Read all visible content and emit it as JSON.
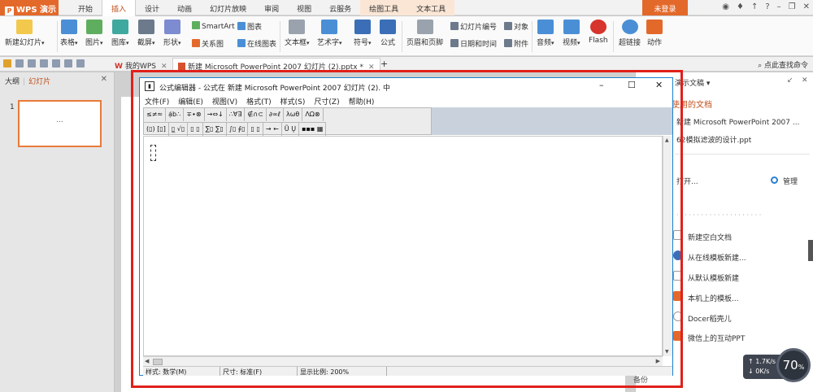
{
  "app": {
    "name": "WPS 演示"
  },
  "tabs": [
    "开始",
    "插入",
    "设计",
    "动画",
    "幻灯片放映",
    "审阅",
    "视图",
    "云服务",
    "绘图工具",
    "文本工具"
  ],
  "active_tab": "插入",
  "login_label": "未登录",
  "ribbon": {
    "new_slide": "新建幻灯片",
    "table": "表格",
    "picture": "图片",
    "gallery": "图库",
    "screenshot": "截屏",
    "shape": "形状",
    "smartart": "SmartArt",
    "chart": "图表",
    "relation": "关系图",
    "online_chart": "在线图表",
    "textbox": "文本框",
    "wordart": "艺术字",
    "symbol": "符号",
    "formula": "公式",
    "header_footer": "页眉和页脚",
    "slide_number": "幻灯片编号",
    "object": "对象",
    "datetime": "日期和时间",
    "attachment": "附件",
    "audio": "音频",
    "video": "视频",
    "flash": "Flash",
    "hyperlink": "超链接",
    "action": "动作"
  },
  "doc_tabs": {
    "mywps": "我的WPS",
    "current": "新建 Microsoft PowerPoint 2007 幻灯片 (2).pptx *",
    "add": "+"
  },
  "search_cmd": "点此查找命令",
  "left_panel": {
    "outline": "大纲",
    "slides": "幻灯片",
    "slide_number": "1",
    "thumb_text": "..."
  },
  "equation_editor": {
    "title": "公式编辑器 - 公式在 新建 Microsoft PowerPoint 2007 幻灯片 (2). 中",
    "menu": [
      "文件(F)",
      "编辑(E)",
      "视图(V)",
      "格式(T)",
      "样式(S)",
      "尺寸(Z)",
      "帮助(H)"
    ],
    "palette_row1": [
      "≤≠≈",
      "ạ̇b∴",
      "∓∙⊗",
      "→⇔↓",
      "∴∀∃",
      "∉∩⊂",
      "∂∞ℓ",
      "λωθ",
      "ΛΩ⊗"
    ],
    "palette_row2": [
      "(▯) [▯]",
      "▯̲ √▯",
      "▯ ▯",
      "∑▯ ∑▯",
      "∫▯ ∮▯",
      "▯ ▯",
      "→ ←",
      "Ũ Ų",
      "▪▪▪ ▦"
    ],
    "status_style": "样式: 数学(M)",
    "status_size": "尺寸: 标准(F)",
    "status_zoom": "显示比例: 200%"
  },
  "right_pane": {
    "header": "演示文稿",
    "recent_title": "使用的文档",
    "recent1": "新建 Microsoft PowerPoint 2007 ...",
    "recent2": "62模拟滤波的设计.ppt",
    "open": "打开...",
    "manage": "管理",
    "new_blank": "新建空白文档",
    "from_online": "从在线模板新建...",
    "from_default": "从默认模板新建",
    "local_template": "本机上的模板...",
    "docer": "Docer稻壳儿",
    "wechat": "微信上的互动PPT",
    "backup": "备份",
    "manage2": "管理"
  },
  "speed": {
    "up": "1.7K/s",
    "down": "0K/s"
  },
  "zoom": {
    "value": "70",
    "unit": "%"
  }
}
